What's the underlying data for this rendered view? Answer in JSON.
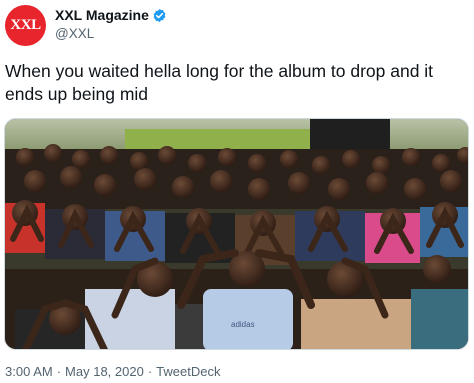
{
  "author": {
    "avatar_text": "XXL",
    "display_name": "XXL Magazine",
    "handle": "@XXL",
    "verified": true,
    "verified_icon": "verified-badge-icon"
  },
  "tweet": {
    "text": "When you waited hella long for the album to drop and it ends up being mid"
  },
  "photo": {
    "subject": "crowd-with-hands-on-heads-photo",
    "shirt_logo_text": "adidas"
  },
  "meta": {
    "time": "3:00 AM",
    "separator": "·",
    "date": "May 18, 2020",
    "source": "TweetDeck"
  },
  "colors": {
    "avatar": "#e8242c",
    "verified": "#1d9bf0",
    "secondary_text": "#536471"
  }
}
